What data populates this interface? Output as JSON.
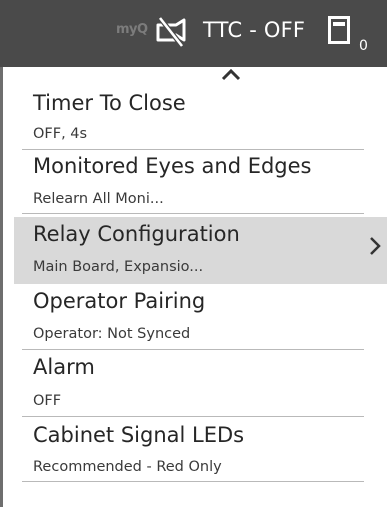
{
  "status_bar": {
    "logo": "myQ",
    "ttc_status": "TTC - OFF",
    "board_count": "0",
    "icons": [
      "camera-off-icon",
      "board-icon"
    ],
    "background_color": "#4a4a4a"
  },
  "menu": {
    "scroll_indicator": "chevron-up-icon",
    "selected_index": 2,
    "items": [
      {
        "title": "Timer To Close",
        "subtitle": "OFF, 4s"
      },
      {
        "title": "Monitored Eyes and Edges",
        "subtitle": "Relearn All Moni..."
      },
      {
        "title": "Relay Configuration",
        "subtitle": "Main Board, Expansio...",
        "has_submenu": true
      },
      {
        "title": "Operator Pairing",
        "subtitle": "Operator: Not Synced"
      },
      {
        "title": "Alarm",
        "subtitle": "OFF"
      },
      {
        "title": "Cabinet Signal LEDs",
        "subtitle": "Recommended - Red Only"
      }
    ]
  }
}
